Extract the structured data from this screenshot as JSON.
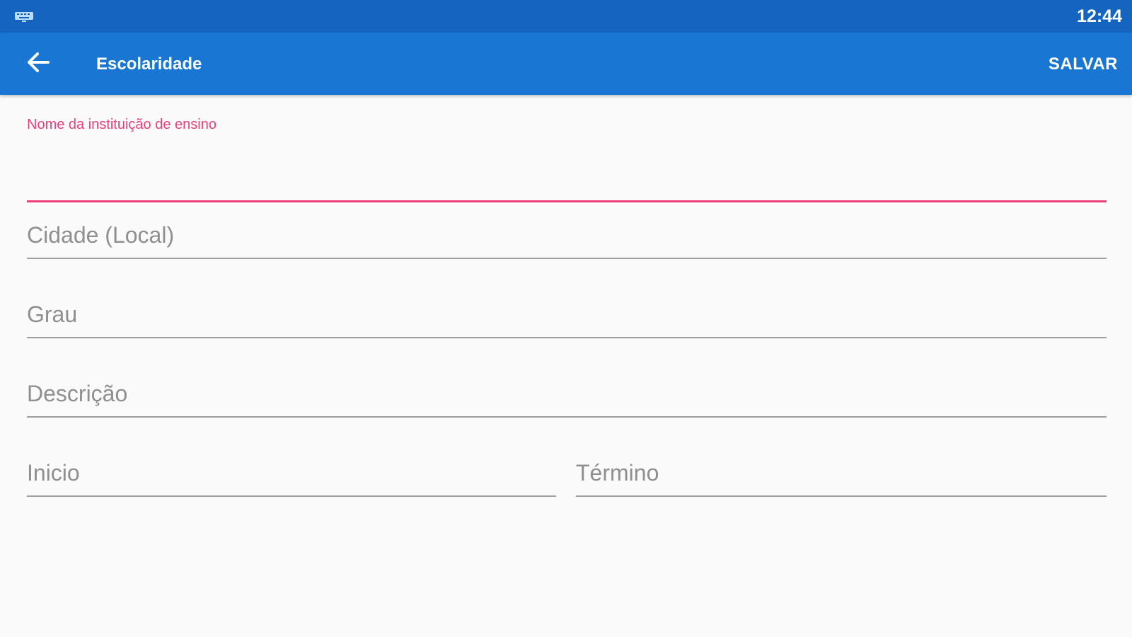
{
  "status_bar": {
    "time": "12:44",
    "keyboard_icon": "keyboard-icon"
  },
  "app_bar": {
    "back_icon": "arrow-back-icon",
    "title": "Escolaridade",
    "save_label": "SALVAR"
  },
  "form": {
    "institution": {
      "label": "Nome da instituição de ensino",
      "value": ""
    },
    "city": {
      "placeholder": "Cidade (Local)",
      "value": ""
    },
    "degree": {
      "placeholder": "Grau",
      "value": ""
    },
    "description": {
      "placeholder": "Descrição",
      "value": ""
    },
    "start": {
      "placeholder": "Inicio",
      "value": ""
    },
    "end": {
      "placeholder": "Término",
      "value": ""
    }
  },
  "colors": {
    "status_bar": "#1565c0",
    "app_bar": "#1976d2",
    "accent": "#ec407a",
    "background": "#fafafa",
    "hint_text": "#8f8f8f",
    "underline": "#9e9e9e"
  }
}
